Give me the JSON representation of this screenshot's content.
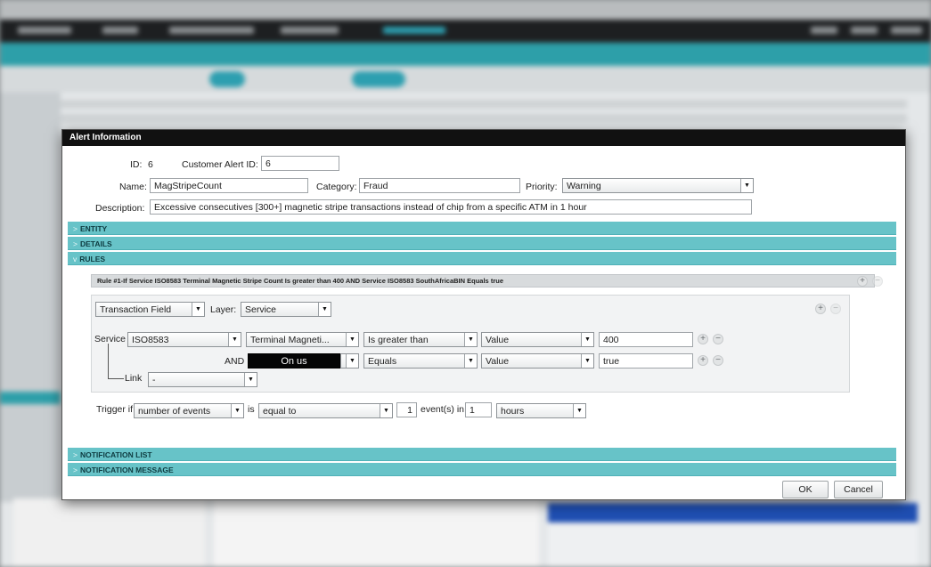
{
  "dialog": {
    "title": "Alert Information",
    "id_label": "ID:",
    "id_value": "6",
    "customer_alert_id_label": "Customer Alert ID:",
    "customer_alert_id_value": "6",
    "name_label": "Name:",
    "name_value": "MagStripeCount",
    "category_label": "Category:",
    "category_value": "Fraud",
    "priority_label": "Priority:",
    "priority_value": "Warning",
    "description_label": "Description:",
    "description_value": "Excessive consecutives [300+] magnetic stripe transactions instead of chip from a specific ATM in 1 hour"
  },
  "sections": {
    "entity": "ENTITY",
    "details": "DETAILS",
    "rules": "RULES",
    "notification_list": "NOTIFICATION LIST",
    "notification_message": "NOTIFICATION MESSAGE"
  },
  "rule": {
    "summary": "Rule #1-If Service ISO8583 Terminal Magnetic Stripe Count Is greater than 400 AND Service ISO8583 SouthAfricaBIN Equals true",
    "field_type": "Transaction Field",
    "layer_label": "Layer:",
    "layer_value": "Service",
    "service_label": "Service",
    "row1": {
      "protocol": "ISO8583",
      "field": "Terminal Magneti...",
      "operator": "Is greater than",
      "value_type": "Value",
      "value": "400"
    },
    "and_label": "AND",
    "row2": {
      "field": "On us",
      "operator": "Equals",
      "value_type": "Value",
      "value": "true"
    },
    "link_label": "Link",
    "link_value": "-"
  },
  "trigger": {
    "label": "Trigger if",
    "measure": "number of events",
    "is_label": "is",
    "comparison": "equal to",
    "count": "1",
    "events_in_label": "event(s) in",
    "period_count": "1",
    "period_unit": "hours"
  },
  "buttons": {
    "ok": "OK",
    "cancel": "Cancel"
  },
  "glyphs": {
    "plus": "+",
    "minus": "−",
    "arrow": "▼",
    "chevron": ">",
    "chevron_open": "v"
  }
}
